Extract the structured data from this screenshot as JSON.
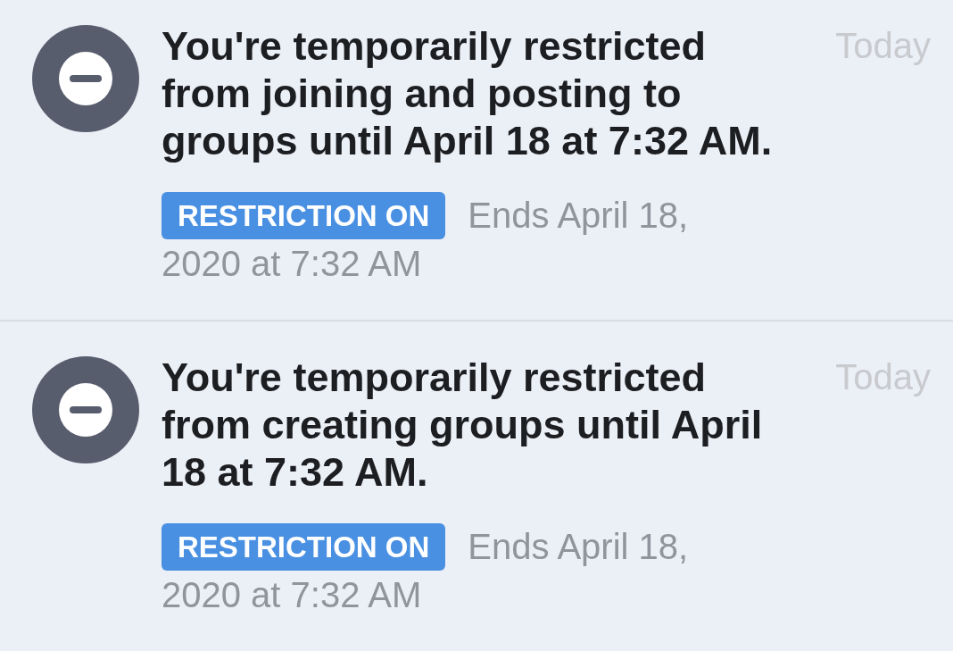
{
  "notifications": [
    {
      "title": "You're temporarily restricted from joining and posting to groups until April 18 at 7:32 AM.",
      "time": "Today",
      "status": "RESTRICTION ON",
      "detail_lines": [
        "Ends April 18,",
        "2020 at 7:32 AM"
      ]
    },
    {
      "title": "You're temporarily restricted from creating groups until April 18 at 7:32 AM.",
      "time": "Today",
      "status": "RESTRICTION ON",
      "detail_lines": [
        "Ends April 18,",
        "2020 at 7:32 AM"
      ]
    }
  ]
}
